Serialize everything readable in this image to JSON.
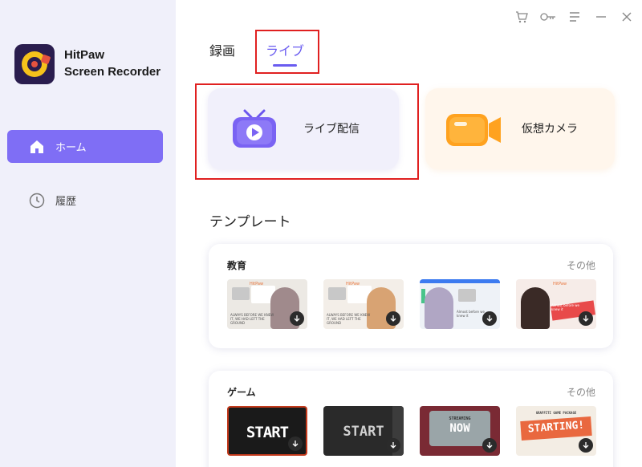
{
  "app": {
    "name_line1": "HitPaw",
    "name_line2": "Screen Recorder"
  },
  "sidebar": {
    "items": [
      {
        "label": "ホーム",
        "icon": "home-icon",
        "active": true
      },
      {
        "label": "履歴",
        "icon": "clock-icon",
        "active": false
      }
    ]
  },
  "window_controls": [
    "cart-icon",
    "key-icon",
    "menu-icon",
    "minimize-icon",
    "close-icon"
  ],
  "tabs": [
    {
      "label": "録画",
      "active": false
    },
    {
      "label": "ライブ",
      "active": true
    }
  ],
  "cards": {
    "live": {
      "label": "ライブ配信",
      "icon": "tv-play-icon"
    },
    "camera": {
      "label": "仮想カメラ",
      "icon": "video-camera-icon"
    }
  },
  "templates": {
    "title": "テンプレート",
    "sections": [
      {
        "title": "教育",
        "more": "その他",
        "thumbnails": [
          {
            "brand": "HitPaw",
            "caption": "ALWAYS BEFORE WE KNEW IT, WE HAD LEFT THE GROUND"
          },
          {
            "brand": "HitPaw",
            "caption": "ALWAYS BEFORE WE KNEW IT, WE HAD LEFT THE GROUND"
          },
          {
            "brand": "",
            "caption": "Almost before we knew it"
          },
          {
            "brand": "HitPaw",
            "caption": "Almost before we knew it"
          }
        ]
      },
      {
        "title": "ゲーム",
        "more": "その他",
        "thumbnails": [
          {
            "brand": "",
            "caption": "START"
          },
          {
            "brand": "",
            "caption": "START"
          },
          {
            "brand": "STREAMING",
            "caption": "NOW"
          },
          {
            "brand": "GRAFFITI GAME PACKAGE",
            "caption": "STARTING!"
          }
        ]
      }
    ]
  },
  "colors": {
    "accent": "#7f6ef5",
    "highlight": "#e02020",
    "sidebar_bg": "#f0f0fa"
  }
}
